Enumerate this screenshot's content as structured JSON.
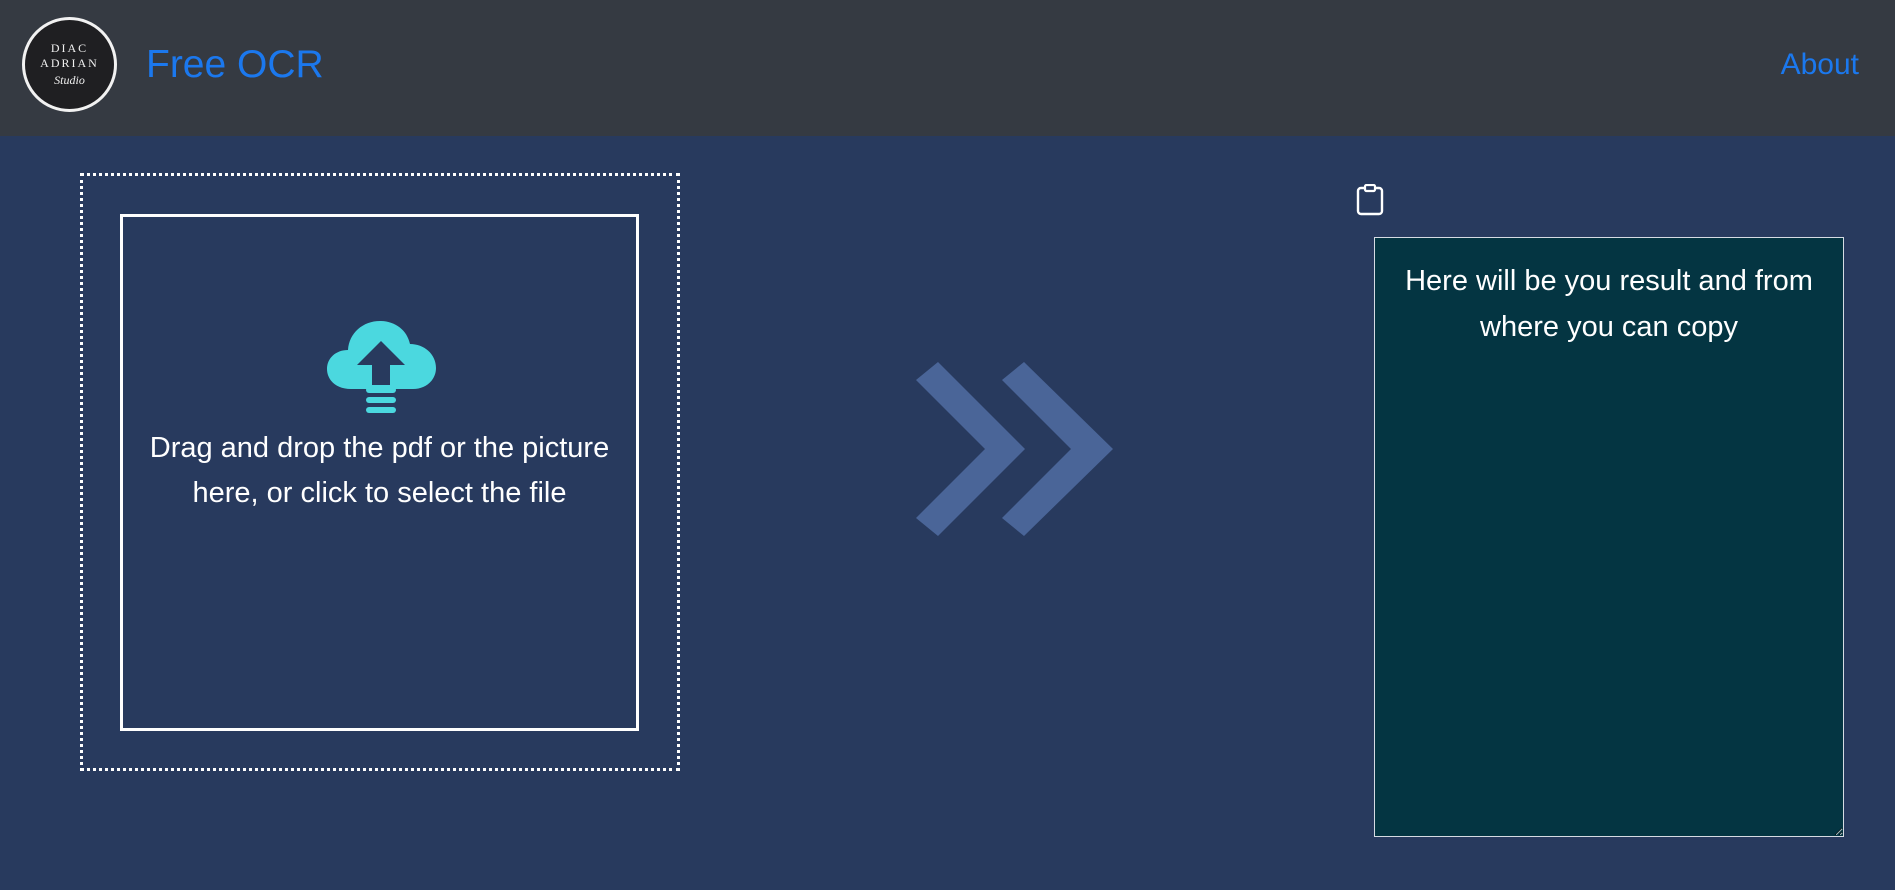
{
  "navbar": {
    "brand": "Free OCR",
    "about": "About",
    "logo": {
      "line1": "DIAC",
      "line2": "ADRIAN",
      "line3": "Studio"
    }
  },
  "dropzone": {
    "text": "Drag and drop the pdf or the picture here, or click to select the file",
    "icon": "cloud-upload-icon"
  },
  "converter": {
    "icon": "double-chevron-right-icon"
  },
  "result": {
    "placeholder": "Here will be you result and from where you can copy",
    "value": "",
    "copy_icon": "clipboard-icon"
  },
  "colors": {
    "navbar_bg": "#353a42",
    "page_bg": "#283a5e",
    "link": "#1b78ee",
    "upload_icon": "#4bd8df",
    "arrow_icon": "#4a6598",
    "result_bg": "#043542"
  }
}
